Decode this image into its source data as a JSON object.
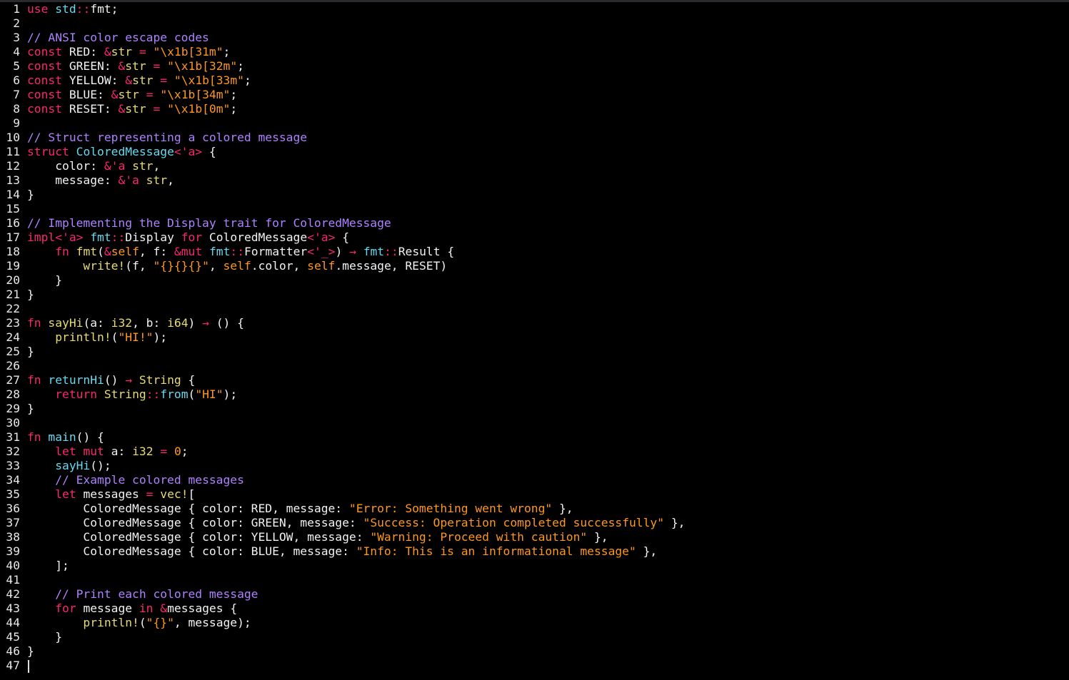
{
  "editor": {
    "language": "rust",
    "cursor_line": 47,
    "colors": {
      "background": "#000000",
      "keyword": "#f92672",
      "type": "#e6db74",
      "namespace": "#66d9ef",
      "string": "#fd971f",
      "comment": "#ae81ff",
      "text": "#f2f2f2"
    },
    "lines": [
      [
        [
          "kw",
          "use"
        ],
        [
          "pl",
          " "
        ],
        [
          "ns",
          "std"
        ],
        [
          "op",
          "::"
        ],
        [
          "pl",
          "fmt;"
        ]
      ],
      [],
      [
        [
          "cm",
          "// ANSI color escape codes"
        ]
      ],
      [
        [
          "kw",
          "const"
        ],
        [
          "pl",
          " RED: "
        ],
        [
          "op",
          "&"
        ],
        [
          "ty",
          "str"
        ],
        [
          "pl",
          " "
        ],
        [
          "op",
          "="
        ],
        [
          "pl",
          " "
        ],
        [
          "str",
          "\"\\x1b[31m\""
        ],
        [
          "pl",
          ";"
        ]
      ],
      [
        [
          "kw",
          "const"
        ],
        [
          "pl",
          " GREEN: "
        ],
        [
          "op",
          "&"
        ],
        [
          "ty",
          "str"
        ],
        [
          "pl",
          " "
        ],
        [
          "op",
          "="
        ],
        [
          "pl",
          " "
        ],
        [
          "str",
          "\"\\x1b[32m\""
        ],
        [
          "pl",
          ";"
        ]
      ],
      [
        [
          "kw",
          "const"
        ],
        [
          "pl",
          " YELLOW: "
        ],
        [
          "op",
          "&"
        ],
        [
          "ty",
          "str"
        ],
        [
          "pl",
          " "
        ],
        [
          "op",
          "="
        ],
        [
          "pl",
          " "
        ],
        [
          "str",
          "\"\\x1b[33m\""
        ],
        [
          "pl",
          ";"
        ]
      ],
      [
        [
          "kw",
          "const"
        ],
        [
          "pl",
          " BLUE: "
        ],
        [
          "op",
          "&"
        ],
        [
          "ty",
          "str"
        ],
        [
          "pl",
          " "
        ],
        [
          "op",
          "="
        ],
        [
          "pl",
          " "
        ],
        [
          "str",
          "\"\\x1b[34m\""
        ],
        [
          "pl",
          ";"
        ]
      ],
      [
        [
          "kw",
          "const"
        ],
        [
          "pl",
          " RESET: "
        ],
        [
          "op",
          "&"
        ],
        [
          "ty",
          "str"
        ],
        [
          "pl",
          " "
        ],
        [
          "op",
          "="
        ],
        [
          "pl",
          " "
        ],
        [
          "str",
          "\"\\x1b[0m\""
        ],
        [
          "pl",
          ";"
        ]
      ],
      [],
      [
        [
          "cm",
          "// Struct representing a colored message"
        ]
      ],
      [
        [
          "kw",
          "struct"
        ],
        [
          "pl",
          " "
        ],
        [
          "dfn",
          "ColoredMessage"
        ],
        [
          "lt",
          "<'a>"
        ],
        [
          "pl",
          " {"
        ]
      ],
      [
        [
          "pl",
          "    color: "
        ],
        [
          "op",
          "&"
        ],
        [
          "lt",
          "'a"
        ],
        [
          "pl",
          " "
        ],
        [
          "ty",
          "str"
        ],
        [
          "pl",
          ","
        ]
      ],
      [
        [
          "pl",
          "    message: "
        ],
        [
          "op",
          "&"
        ],
        [
          "lt",
          "'a"
        ],
        [
          "pl",
          " "
        ],
        [
          "ty",
          "str"
        ],
        [
          "pl",
          ","
        ]
      ],
      [
        [
          "pl",
          "}"
        ]
      ],
      [],
      [
        [
          "cm",
          "// Implementing the Display trait for ColoredMessage"
        ]
      ],
      [
        [
          "kw",
          "impl"
        ],
        [
          "lt",
          "<'a>"
        ],
        [
          "pl",
          " "
        ],
        [
          "ns",
          "fmt"
        ],
        [
          "op",
          "::"
        ],
        [
          "pl",
          "Display "
        ],
        [
          "kw",
          "for"
        ],
        [
          "pl",
          " ColoredMessage"
        ],
        [
          "lt",
          "<'a>"
        ],
        [
          "pl",
          " {"
        ]
      ],
      [
        [
          "pl",
          "    "
        ],
        [
          "kw",
          "fn"
        ],
        [
          "pl",
          " "
        ],
        [
          "mac",
          "fmt"
        ],
        [
          "pl",
          "("
        ],
        [
          "op",
          "&"
        ],
        [
          "self",
          "self"
        ],
        [
          "pl",
          ", f: "
        ],
        [
          "op",
          "&"
        ],
        [
          "kw",
          "mut"
        ],
        [
          "pl",
          " "
        ],
        [
          "ns",
          "fmt"
        ],
        [
          "op",
          "::"
        ],
        [
          "pl",
          "Formatter"
        ],
        [
          "lt",
          "<'_>"
        ],
        [
          "pl",
          ") "
        ],
        [
          "op",
          "→"
        ],
        [
          "pl",
          " "
        ],
        [
          "ns",
          "fmt"
        ],
        [
          "op",
          "::"
        ],
        [
          "pl",
          "Result {"
        ]
      ],
      [
        [
          "pl",
          "        "
        ],
        [
          "mac",
          "write!"
        ],
        [
          "pl",
          "(f, "
        ],
        [
          "str",
          "\"{}{}{}\""
        ],
        [
          "pl",
          ", "
        ],
        [
          "self",
          "self"
        ],
        [
          "pl",
          ".color, "
        ],
        [
          "self",
          "self"
        ],
        [
          "pl",
          ".message, RESET)"
        ]
      ],
      [
        [
          "pl",
          "    }"
        ]
      ],
      [
        [
          "pl",
          "}"
        ]
      ],
      [],
      [
        [
          "kw",
          "fn"
        ],
        [
          "pl",
          " "
        ],
        [
          "mac",
          "sayHi"
        ],
        [
          "pl",
          "(a: "
        ],
        [
          "ty",
          "i32"
        ],
        [
          "pl",
          ", b: "
        ],
        [
          "ty",
          "i64"
        ],
        [
          "pl",
          ") "
        ],
        [
          "op",
          "→"
        ],
        [
          "pl",
          " () {"
        ]
      ],
      [
        [
          "pl",
          "    "
        ],
        [
          "mac",
          "println!"
        ],
        [
          "pl",
          "("
        ],
        [
          "str",
          "\"HI!\""
        ],
        [
          "pl",
          ");"
        ]
      ],
      [
        [
          "pl",
          "}"
        ]
      ],
      [],
      [
        [
          "kw",
          "fn"
        ],
        [
          "pl",
          " "
        ],
        [
          "dfn",
          "returnHi"
        ],
        [
          "pl",
          "() "
        ],
        [
          "op",
          "→"
        ],
        [
          "pl",
          " "
        ],
        [
          "ty",
          "String"
        ],
        [
          "pl",
          " {"
        ]
      ],
      [
        [
          "pl",
          "    "
        ],
        [
          "kw",
          "return"
        ],
        [
          "pl",
          " "
        ],
        [
          "ty",
          "String"
        ],
        [
          "op",
          "::"
        ],
        [
          "dfn",
          "from"
        ],
        [
          "pl",
          "("
        ],
        [
          "str",
          "\"HI\""
        ],
        [
          "pl",
          ");"
        ]
      ],
      [
        [
          "pl",
          "}"
        ]
      ],
      [],
      [
        [
          "kw",
          "fn"
        ],
        [
          "pl",
          " "
        ],
        [
          "dfn",
          "main"
        ],
        [
          "pl",
          "() {"
        ]
      ],
      [
        [
          "pl",
          "    "
        ],
        [
          "kw",
          "let"
        ],
        [
          "pl",
          " "
        ],
        [
          "kw",
          "mut"
        ],
        [
          "pl",
          " a: "
        ],
        [
          "ty",
          "i32"
        ],
        [
          "pl",
          " "
        ],
        [
          "op",
          "="
        ],
        [
          "pl",
          " "
        ],
        [
          "num",
          "0"
        ],
        [
          "pl",
          ";"
        ]
      ],
      [
        [
          "pl",
          "    "
        ],
        [
          "dfn",
          "sayHi"
        ],
        [
          "pl",
          "();"
        ]
      ],
      [
        [
          "pl",
          "    "
        ],
        [
          "cm",
          "// Example colored messages"
        ]
      ],
      [
        [
          "pl",
          "    "
        ],
        [
          "kw",
          "let"
        ],
        [
          "pl",
          " messages "
        ],
        [
          "op",
          "="
        ],
        [
          "pl",
          " "
        ],
        [
          "mac",
          "vec!"
        ],
        [
          "pl",
          "["
        ]
      ],
      [
        [
          "pl",
          "        ColoredMessage { color: RED, message: "
        ],
        [
          "str",
          "\"Error: Something went wrong\""
        ],
        [
          "pl",
          " },"
        ]
      ],
      [
        [
          "pl",
          "        ColoredMessage { color: GREEN, message: "
        ],
        [
          "str",
          "\"Success: Operation completed successfully\""
        ],
        [
          "pl",
          " },"
        ]
      ],
      [
        [
          "pl",
          "        ColoredMessage { color: YELLOW, message: "
        ],
        [
          "str",
          "\"Warning: Proceed with caution\""
        ],
        [
          "pl",
          " },"
        ]
      ],
      [
        [
          "pl",
          "        ColoredMessage { color: BLUE, message: "
        ],
        [
          "str",
          "\"Info: This is an informational message\""
        ],
        [
          "pl",
          " },"
        ]
      ],
      [
        [
          "pl",
          "    ];"
        ]
      ],
      [],
      [
        [
          "pl",
          "    "
        ],
        [
          "cm",
          "// Print each colored message"
        ]
      ],
      [
        [
          "pl",
          "    "
        ],
        [
          "kw",
          "for"
        ],
        [
          "pl",
          " message "
        ],
        [
          "kw",
          "in"
        ],
        [
          "pl",
          " "
        ],
        [
          "op",
          "&"
        ],
        [
          "pl",
          "messages {"
        ]
      ],
      [
        [
          "pl",
          "        "
        ],
        [
          "mac",
          "println!"
        ],
        [
          "pl",
          "("
        ],
        [
          "str",
          "\"{}\""
        ],
        [
          "pl",
          ", message);"
        ]
      ],
      [
        [
          "pl",
          "    }"
        ]
      ],
      [
        [
          "pl",
          "}"
        ]
      ],
      []
    ]
  }
}
